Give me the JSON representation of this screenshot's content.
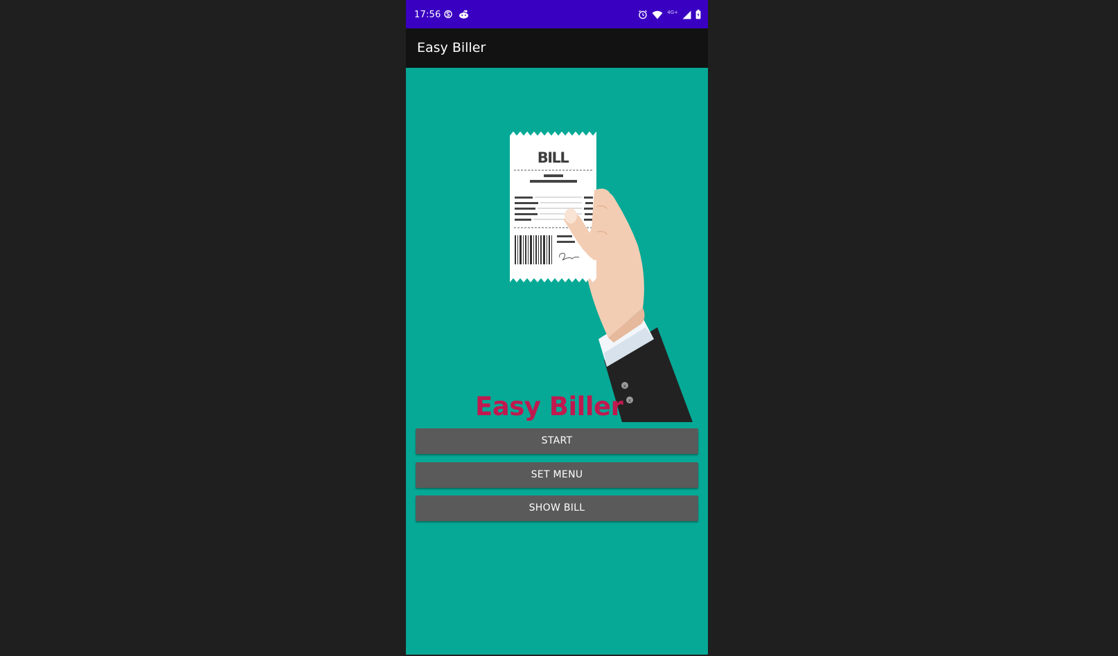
{
  "status_bar": {
    "time": "17:56",
    "network_label": "4G+",
    "left_icons": [
      "s-circle-icon",
      "reddit-icon"
    ],
    "right_icons": [
      "alarm-icon",
      "wifi-icon",
      "signal-icon",
      "battery-icon"
    ],
    "background": "#3a00c2"
  },
  "app_bar": {
    "title": "Easy Biller",
    "background": "#121212"
  },
  "main": {
    "background": "#06a996",
    "illustration_text": "BILL",
    "brand_title": "Easy Biller",
    "brand_color": "#c0194f",
    "buttons": [
      {
        "label": "START"
      },
      {
        "label": "SET MENU"
      },
      {
        "label": "SHOW BILL"
      }
    ],
    "button_color": "#5a5a5a"
  }
}
